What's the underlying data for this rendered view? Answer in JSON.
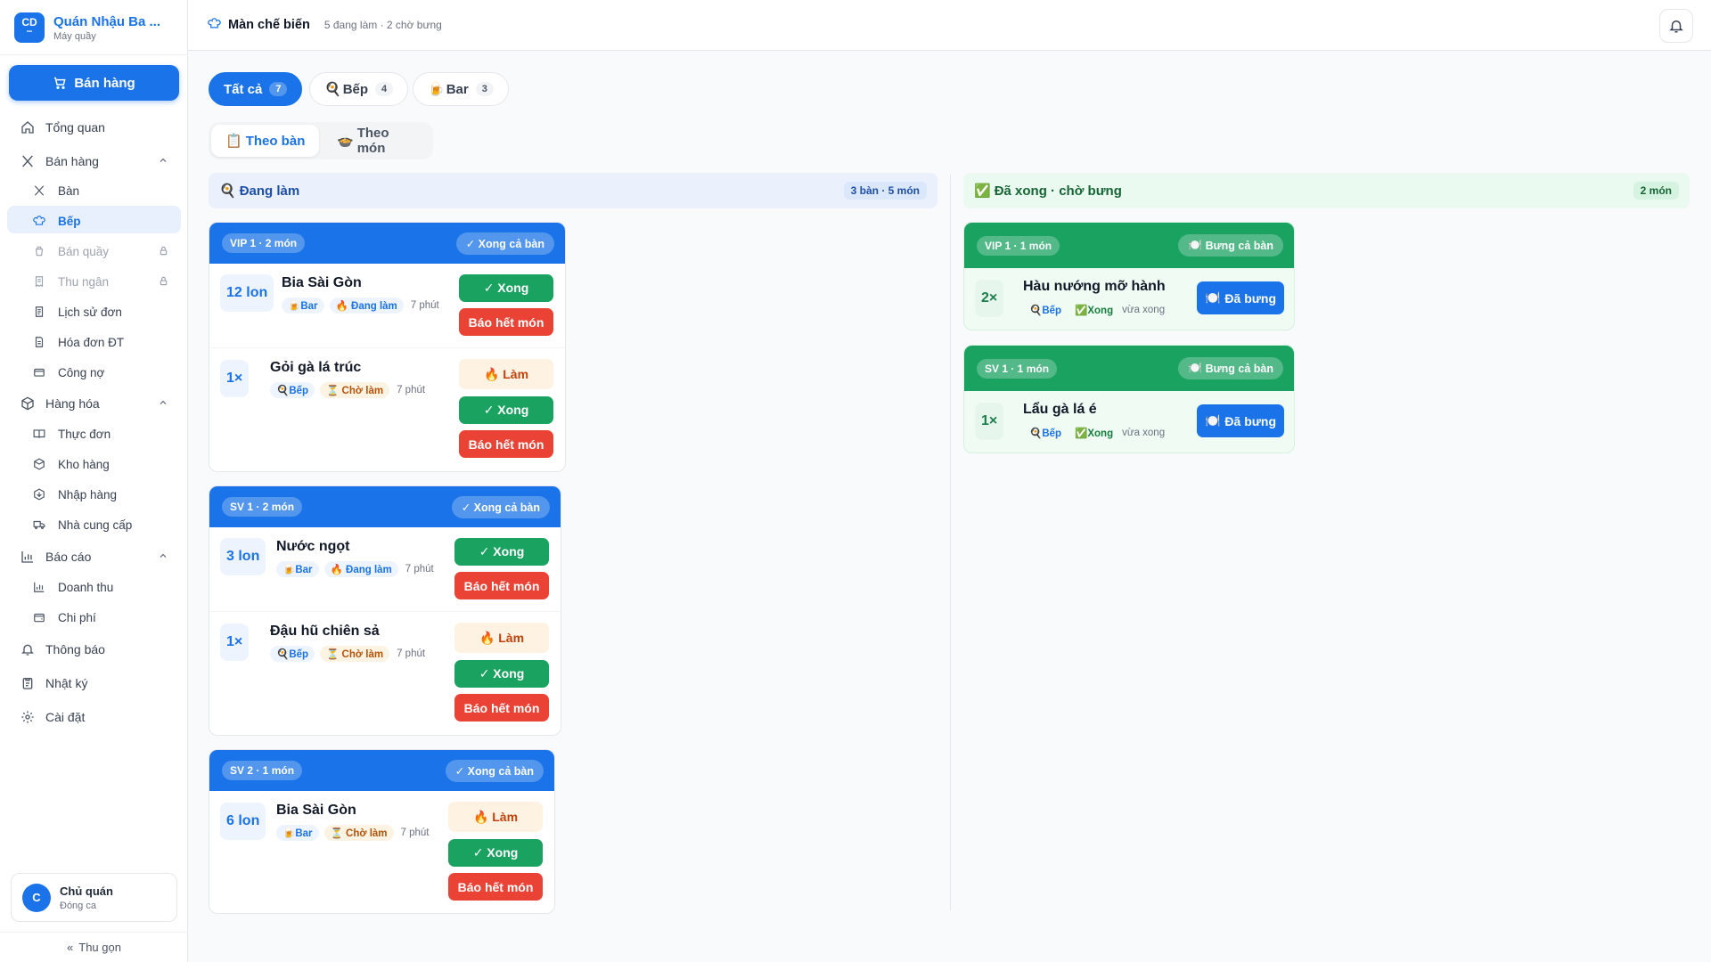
{
  "brand": {
    "logo": "CD",
    "logo_sub": "•••",
    "name": "Quán Nhậu Ba ...",
    "subtitle": "Máy quầy"
  },
  "sidebar": {
    "sell_button": "Bán hàng",
    "items": [
      {
        "label": "Tổng quan",
        "icon": "home-icon"
      },
      {
        "label": "Bán hàng",
        "icon": "utensils-icon"
      },
      {
        "label": "Bàn",
        "icon": "utensils-icon"
      },
      {
        "label": "Bếp",
        "icon": "chef-hat-icon"
      },
      {
        "label": "Bán quầy",
        "icon": "cup-icon"
      },
      {
        "label": "Thu ngân",
        "icon": "receipt-icon"
      },
      {
        "label": "Lịch sử đơn",
        "icon": "history-icon"
      },
      {
        "label": "Hóa đơn ĐT",
        "icon": "document-icon"
      },
      {
        "label": "Công nợ",
        "icon": "card-icon"
      },
      {
        "label": "Hàng hóa",
        "icon": "package-icon"
      },
      {
        "label": "Thực đơn",
        "icon": "book-icon"
      },
      {
        "label": "Kho hàng",
        "icon": "box-icon"
      },
      {
        "label": "Nhập hàng",
        "icon": "box-in-icon"
      },
      {
        "label": "Nhà cung cấp",
        "icon": "truck-icon"
      },
      {
        "label": "Báo cáo",
        "icon": "bar-chart-icon"
      },
      {
        "label": "Doanh thu",
        "icon": "bar-chart-icon"
      },
      {
        "label": "Chi phí",
        "icon": "wallet-icon"
      },
      {
        "label": "Thông báo",
        "icon": "bell-icon"
      },
      {
        "label": "Nhật ký",
        "icon": "clipboard-icon"
      },
      {
        "label": "Cài đặt",
        "icon": "gear-icon"
      }
    ],
    "user": {
      "initial": "C",
      "name": "Chủ quán",
      "role": "Đóng ca"
    },
    "collapse": "Thu gọn"
  },
  "topbar": {
    "title": "Màn chế biến",
    "subtitle": "5 đang làm · 2 chờ bưng"
  },
  "filters": [
    {
      "emoji": "",
      "label": "Tất cả",
      "count": "7"
    },
    {
      "emoji": "🍳",
      "label": "Bếp",
      "count": "4"
    },
    {
      "emoji": "🍺",
      "label": "Bar",
      "count": "3"
    }
  ],
  "views": [
    {
      "emoji": "📋",
      "label": "Theo bàn"
    },
    {
      "emoji": "🍲",
      "label": "Theo món"
    }
  ],
  "columns": {
    "doing": {
      "emoji": "🍳",
      "title": "Đang làm",
      "count": "3 bàn · 5 món"
    },
    "done": {
      "emoji": "✅",
      "title": "Đã xong · chờ bưng",
      "count": "2 món"
    }
  },
  "labels": {
    "complete_table": "✓ Xong cả bàn",
    "serve_table": "Bưng cả bàn",
    "done": "✓ Xong",
    "out": "Báo hết món",
    "make": "🔥 Làm",
    "served": "Đã bưng",
    "doing_status": "🔥 Đang làm",
    "wait_status": "⏳ Chờ làm",
    "done_status": "✅Xong",
    "st_bar": "🍺Bar",
    "st_kitchen": "🍳Bếp"
  },
  "doing_tables": [
    {
      "table": "VIP 1 · 2 món",
      "items": [
        {
          "qty": "12 lon",
          "name": "Bia Sài Gòn",
          "time": "7 phút"
        },
        {
          "qty": "1×",
          "name": "Gỏi gà lá trúc",
          "time": "7 phút"
        }
      ]
    },
    {
      "table": "SV 1 · 2 món",
      "items": [
        {
          "qty": "3 lon",
          "name": "Nước ngọt",
          "time": "7 phút"
        },
        {
          "qty": "1×",
          "name": "Đậu hũ chiên sả",
          "time": "7 phút"
        }
      ]
    },
    {
      "table": "SV 2 · 1 món",
      "items": [
        {
          "qty": "6 lon",
          "name": "Bia Sài Gòn",
          "time": "7 phút"
        }
      ]
    }
  ],
  "done_tables": [
    {
      "table": "VIP 1 · 1 món",
      "qty": "2×",
      "name": "Hàu nướng mỡ hành",
      "time": "vừa xong"
    },
    {
      "table": "SV 1 · 1 món",
      "qty": "1×",
      "name": "Lẩu gà lá é",
      "time": "vừa xong"
    }
  ]
}
